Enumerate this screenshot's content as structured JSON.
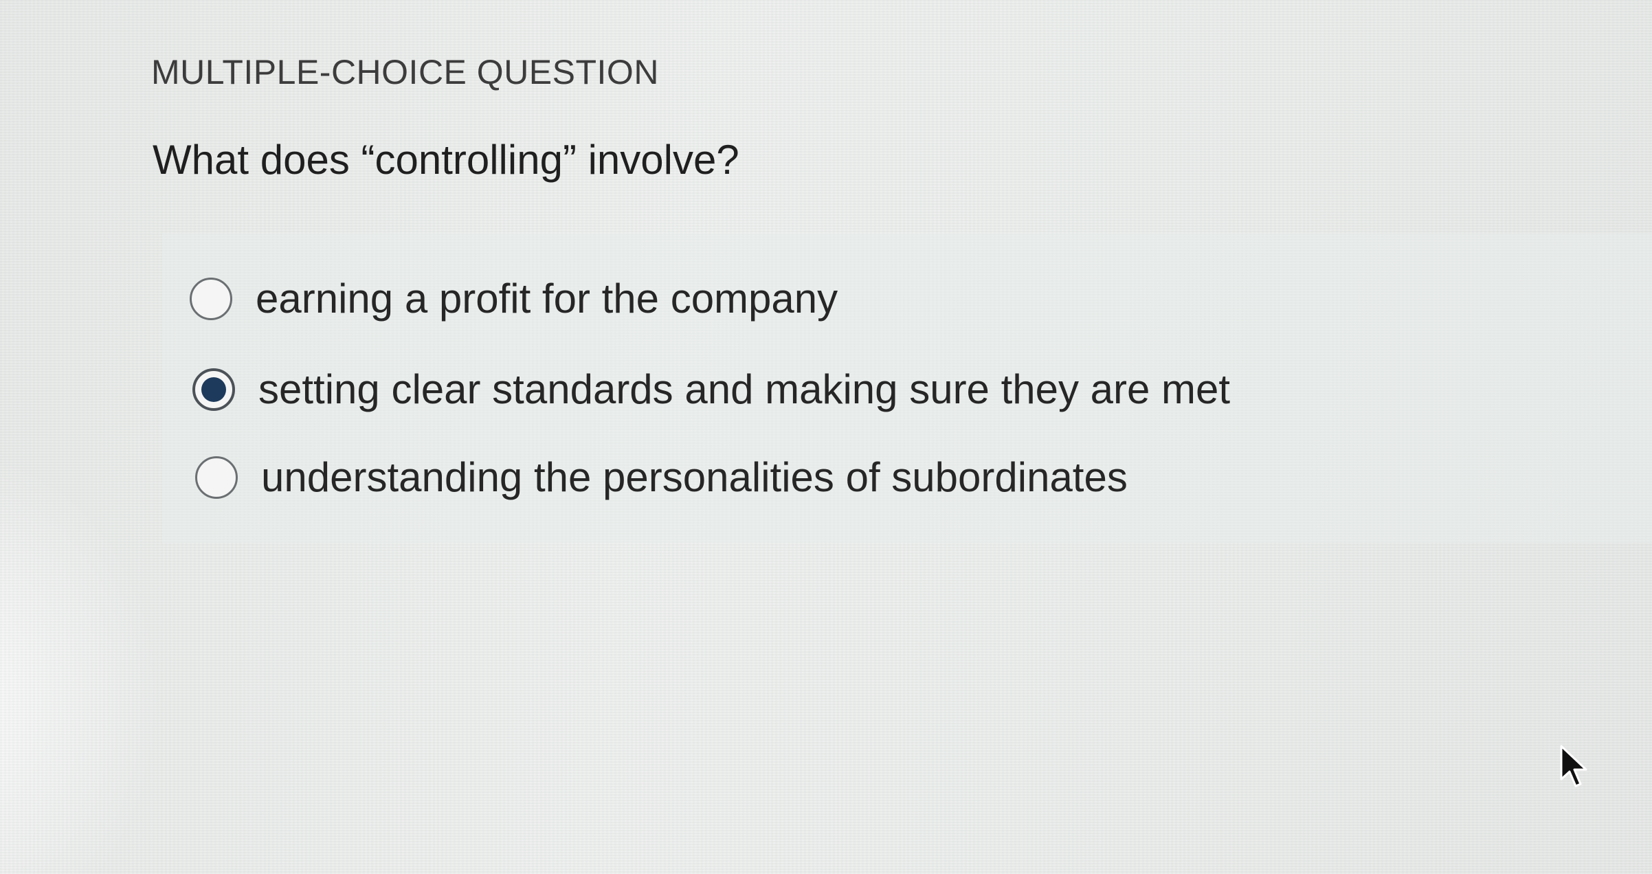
{
  "question": {
    "type_label": "MULTIPLE-CHOICE QUESTION",
    "prompt": "What does “controlling” involve?",
    "options": [
      {
        "label": "earning a profit for the company",
        "selected": false
      },
      {
        "label": "setting clear standards and making sure they are met",
        "selected": true
      },
      {
        "label": "understanding the personalities of subordinates",
        "selected": false
      }
    ]
  },
  "icons": {
    "cursor": "arrow-pointer-icon",
    "radio_unselected": "radio-empty-icon",
    "radio_selected": "radio-filled-icon"
  },
  "colors": {
    "selected_radio_fill": "#1d3a5c",
    "text": "#262626",
    "background": "#e9ebe9"
  }
}
